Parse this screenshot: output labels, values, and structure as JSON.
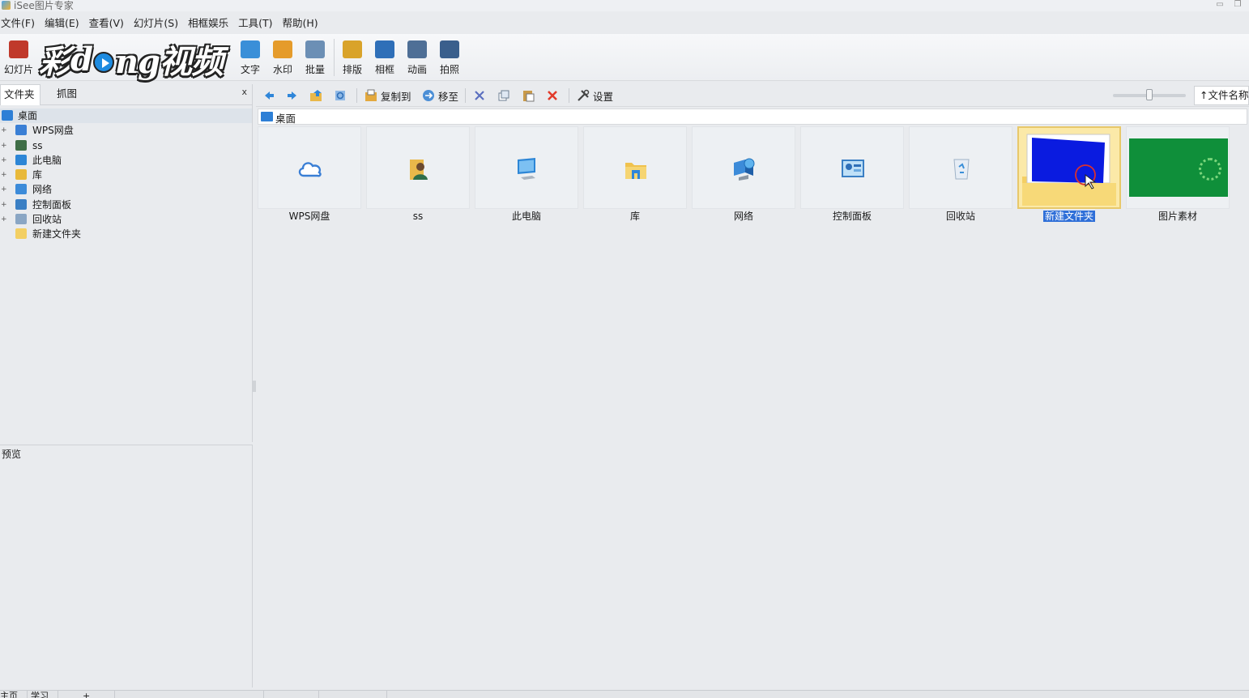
{
  "window": {
    "title": "iSee图片专家"
  },
  "menu": [
    "文件(F)",
    "编辑(E)",
    "查看(V)",
    "幻灯片(S)",
    "相框娱乐",
    "工具(T)",
    "帮助(H)"
  ],
  "watermark": {
    "text_a": "彩",
    "text_b": "d",
    "text_c": "ng视频"
  },
  "toolbar": [
    {
      "label": "幻灯片",
      "icon": "slideshow-icon",
      "color": "#c0392b"
    },
    {
      "label": "文字",
      "icon": "text-icon",
      "color": "#3a8fd8"
    },
    {
      "label": "水印",
      "icon": "watermark-icon",
      "color": "#e59b2b"
    },
    {
      "label": "批量",
      "icon": "batch-icon",
      "color": "#6c8fb5"
    },
    {
      "label": "排版",
      "icon": "layout-icon",
      "color": "#d9a32a"
    },
    {
      "label": "相框",
      "icon": "frame-icon",
      "color": "#2f6fb8"
    },
    {
      "label": "动画",
      "icon": "animation-icon",
      "color": "#4f6f96"
    },
    {
      "label": "拍照",
      "icon": "camera-icon",
      "color": "#3a5f8c"
    }
  ],
  "left_tabs": {
    "folders": "文件夹",
    "capture": "抓图",
    "close": "x"
  },
  "tree": {
    "root": "桌面",
    "items": [
      {
        "label": "WPS网盘",
        "icon": "cloud-icon",
        "color": "#3a7fd5"
      },
      {
        "label": "ss",
        "icon": "user-icon",
        "color": "#3f6e47"
      },
      {
        "label": "此电脑",
        "icon": "computer-icon",
        "color": "#2d86d6"
      },
      {
        "label": "库",
        "icon": "library-icon",
        "color": "#e8b93a"
      },
      {
        "label": "网络",
        "icon": "network-icon",
        "color": "#3c8bd9"
      },
      {
        "label": "控制面板",
        "icon": "control-panel-icon",
        "color": "#3a7fc4"
      },
      {
        "label": "回收站",
        "icon": "recycle-bin-icon",
        "color": "#8aa6c4"
      },
      {
        "label": "新建文件夹",
        "icon": "folder-icon",
        "color": "#f3cf63"
      }
    ]
  },
  "preview": {
    "label": "预览"
  },
  "right_toolbar": {
    "copy_to": "复制到",
    "move_to": "移至",
    "settings": "设置",
    "sort": "↑文件名称"
  },
  "path": {
    "current": "桌面"
  },
  "thumbnails": [
    {
      "label": "WPS网盘",
      "kind": "cloud"
    },
    {
      "label": "ss",
      "kind": "user"
    },
    {
      "label": "此电脑",
      "kind": "pc"
    },
    {
      "label": "库",
      "kind": "library"
    },
    {
      "label": "网络",
      "kind": "network"
    },
    {
      "label": "控制面板",
      "kind": "control-panel"
    },
    {
      "label": "回收站",
      "kind": "recycle-bin"
    },
    {
      "label": "新建文件夹",
      "kind": "folder",
      "selected": true
    },
    {
      "label": "图片素材",
      "kind": "image"
    }
  ],
  "status": [
    "主页",
    "学习",
    "+"
  ]
}
